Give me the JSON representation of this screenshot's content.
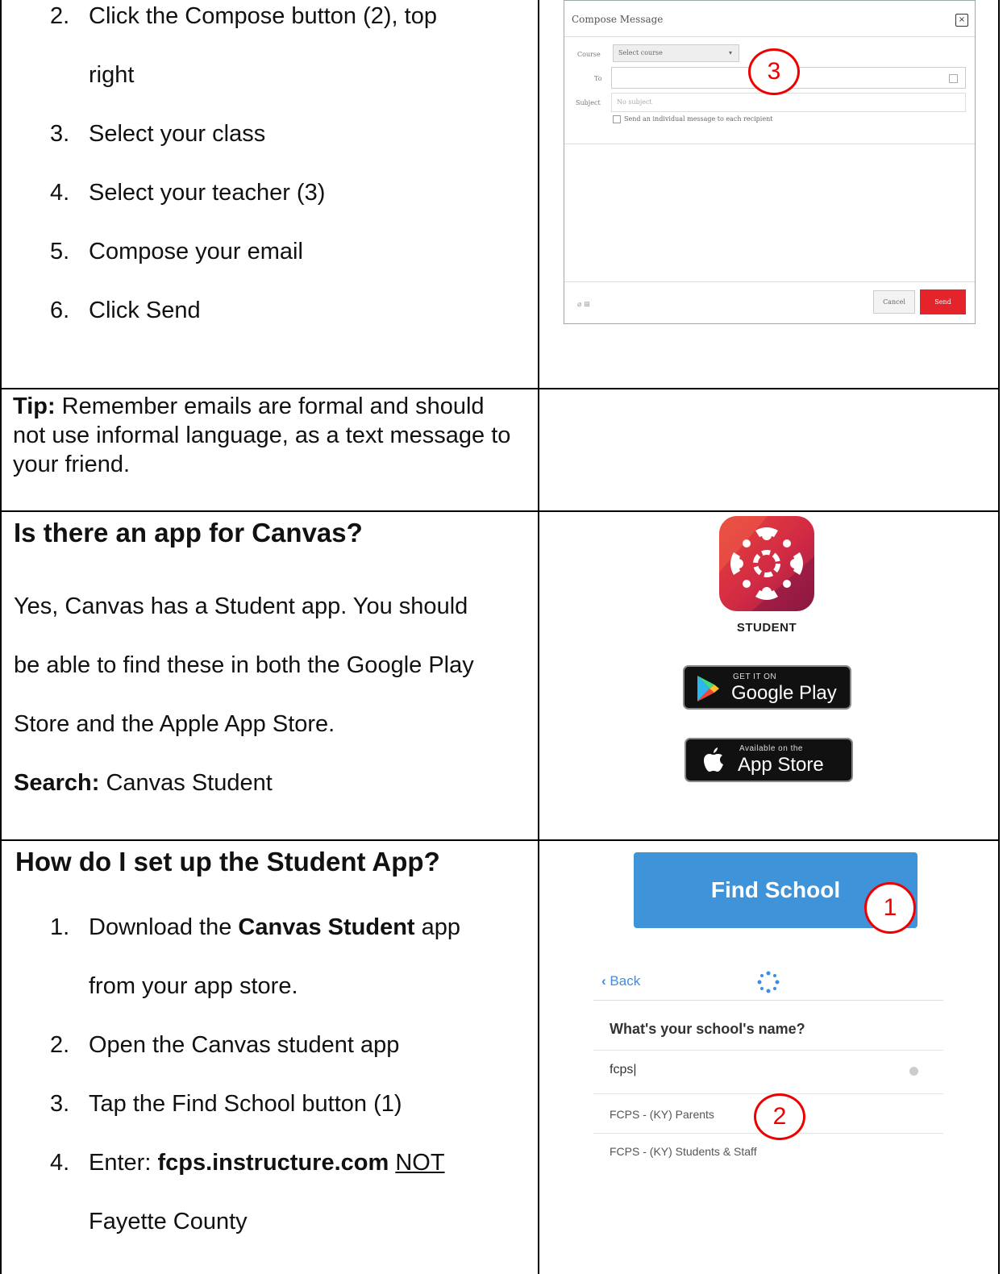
{
  "steps_top": [
    {
      "num": "2.",
      "text": "Click the Compose button (2), top"
    },
    {
      "num": "",
      "text": "right"
    },
    {
      "num": "3.",
      "text": "Select your class"
    },
    {
      "num": "4.",
      "text": "Select your teacher (3)"
    },
    {
      "num": "5.",
      "text": "Compose your email"
    },
    {
      "num": "6.",
      "text": "Click Send"
    }
  ],
  "compose": {
    "title": "Compose Message",
    "course_label": "Course",
    "course_value": "Select course",
    "to_label": "To",
    "subject_label": "Subject",
    "subject_placeholder": "No subject",
    "individual_label": "Send an individual message to each recipient",
    "cancel": "Cancel",
    "send": "Send",
    "callout": "3"
  },
  "tip": {
    "label": "Tip:",
    "text": " Remember emails are formal and should not use informal language, as a text message to your friend."
  },
  "app_section": {
    "heading": "Is there an app for Canvas?",
    "lines": [
      "Yes, Canvas has a Student app. You should",
      "be able to find these in both the Google Play",
      "Store and the Apple App Store."
    ],
    "search_label": "Search:",
    "search_value": " Canvas Student",
    "icon_label": "STUDENT",
    "google_small": "GET IT ON",
    "google_big": "Google Play",
    "apple_small": "Available on the",
    "apple_big": "App Store"
  },
  "setup_section": {
    "heading": "How do I set up the Student App?",
    "step1_num": "1.",
    "step1_pre": "Download the ",
    "step1_bold": "Canvas Student",
    "step1_post": " app",
    "step1_cont": "from your app store.",
    "step2_num": "2.",
    "step2": "Open the Canvas student app",
    "step3_num": "3.",
    "step3": "Tap the Find School button (1)",
    "step4_num": "4.",
    "step4_pre": "Enter: ",
    "step4_bold": "fcps.instructure.com",
    "step4_space": " ",
    "step4_u": "NOT",
    "step4_cont": "Fayette County"
  },
  "mobile": {
    "find_school": "Find School",
    "callout1": "1",
    "back": "Back",
    "question": "What's your school's name?",
    "field_value": "fcps",
    "result1": "FCPS - (KY) Parents",
    "result2": "FCPS - (KY) Students & Staff",
    "callout2": "2"
  }
}
